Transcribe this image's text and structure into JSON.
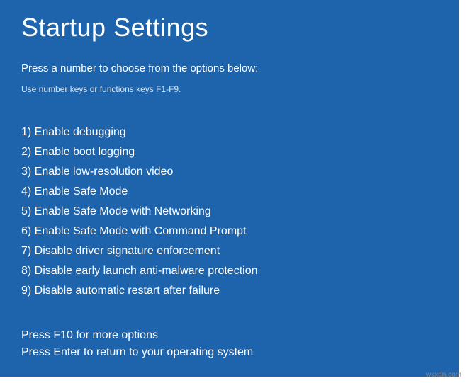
{
  "title": "Startup Settings",
  "instruction": "Press a number to choose from the options below:",
  "hint": "Use number keys or functions keys F1-F9.",
  "options": [
    "1) Enable debugging",
    "2) Enable boot logging",
    "3) Enable low-resolution video",
    "4) Enable Safe Mode",
    "5) Enable Safe Mode with Networking",
    "6) Enable Safe Mode with Command Prompt",
    "7) Disable driver signature enforcement",
    "8) Disable early launch anti-malware protection",
    "9) Disable automatic restart after failure"
  ],
  "footer": {
    "more": "Press F10 for more options",
    "return": "Press Enter to return to your operating system"
  },
  "watermark": "wsxdn.com"
}
